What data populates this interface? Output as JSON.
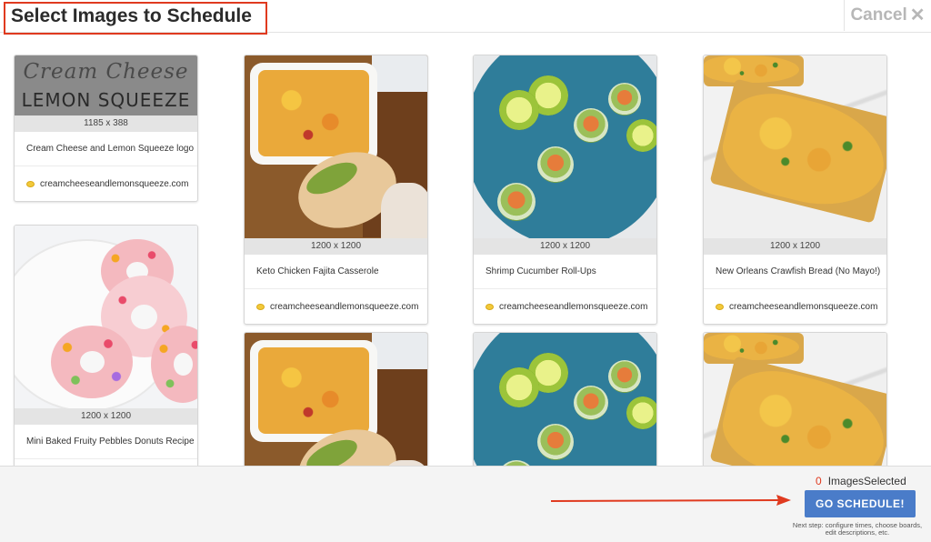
{
  "header": {
    "title": "Select Images to Schedule",
    "cancel_label": "Cancel",
    "cancel_icon": "close-icon"
  },
  "logo_image": {
    "line1": "Cream Cheese",
    "line2": "LEMON SQUEEZE"
  },
  "cards": [
    {
      "dims": "1185 x 388",
      "title": "Cream Cheese and Lemon Squeeze logo",
      "source": "creamcheeseandlemonsqueeze.com",
      "image": "logo"
    },
    {
      "dims": "1200 x 1200",
      "title": "Mini Baked Fruity Pebbles Donuts Recipe",
      "source": "creamcheeseandlemonsqueeze.com",
      "image": "donuts"
    },
    {
      "dims": "1200 x 1200",
      "title": "Keto Chicken Fajita Casserole",
      "source": "creamcheeseandlemonsqueeze.com",
      "image": "casserole"
    },
    {
      "dims": "1200 x 1200",
      "title": "Shrimp Cucumber Roll-Ups",
      "source": "creamcheeseandlemonsqueeze.com",
      "image": "shrimp"
    },
    {
      "dims": "1200 x 1200",
      "title": "New Orleans Crawfish Bread (No Mayo!)",
      "source": "creamcheeseandlemonsqueeze.com",
      "image": "bread"
    },
    {
      "image": "casserole"
    },
    {
      "image": "shrimp"
    },
    {
      "image": "bread"
    }
  ],
  "footer": {
    "selected_count": "0",
    "selected_label": "ImagesSelected",
    "go_label": "GO SCHEDULE!",
    "hint": "Next step: configure times, choose boards, edit descriptions, etc."
  },
  "colors": {
    "accent_red": "#e03a1f",
    "button_blue": "#4a7cc9"
  }
}
